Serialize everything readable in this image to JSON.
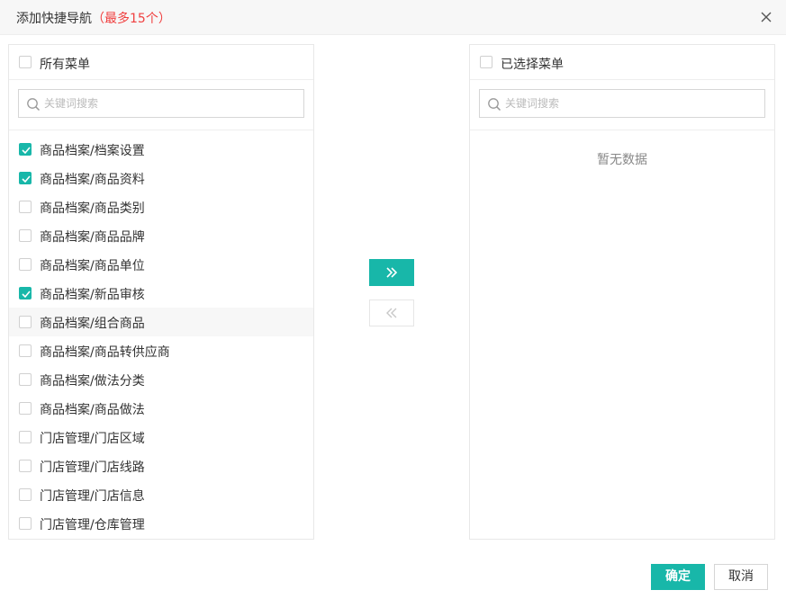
{
  "dialog": {
    "title": "添加快捷导航",
    "title_note": "（最多15个）"
  },
  "left_panel": {
    "header_label": "所有菜单",
    "search_placeholder": "关键词搜索",
    "items": [
      {
        "label": "商品档案/档案设置",
        "checked": true
      },
      {
        "label": "商品档案/商品资料",
        "checked": true
      },
      {
        "label": "商品档案/商品类别",
        "checked": false
      },
      {
        "label": "商品档案/商品品牌",
        "checked": false
      },
      {
        "label": "商品档案/商品单位",
        "checked": false
      },
      {
        "label": "商品档案/新品审核",
        "checked": true
      },
      {
        "label": "商品档案/组合商品",
        "checked": false
      },
      {
        "label": "商品档案/商品转供应商",
        "checked": false
      },
      {
        "label": "商品档案/做法分类",
        "checked": false
      },
      {
        "label": "商品档案/商品做法",
        "checked": false
      },
      {
        "label": "门店管理/门店区域",
        "checked": false
      },
      {
        "label": "门店管理/门店线路",
        "checked": false
      },
      {
        "label": "门店管理/门店信息",
        "checked": false
      },
      {
        "label": "门店管理/仓库管理",
        "checked": false
      }
    ]
  },
  "right_panel": {
    "header_label": "已选择菜单",
    "search_placeholder": "关键词搜索",
    "empty_text": "暂无数据"
  },
  "footer": {
    "ok_label": "确定",
    "cancel_label": "取消"
  },
  "colors": {
    "accent": "#18b7a9",
    "note": "#f04040"
  }
}
